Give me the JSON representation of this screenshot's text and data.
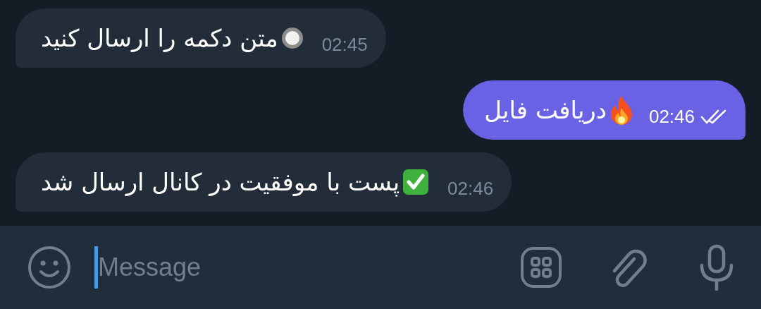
{
  "messages": [
    {
      "text": "متن دکمه را ارسال کنید",
      "time": "02:45",
      "outgoing": false,
      "kind": "radio",
      "read": false
    },
    {
      "text": "دریافت فایل",
      "time": "02:46",
      "outgoing": true,
      "kind": "fire",
      "read": true
    },
    {
      "text": "پست با موفقیت در کانال ارسال شد",
      "time": "02:46",
      "outgoing": false,
      "kind": "check",
      "read": false
    }
  ],
  "composer": {
    "placeholder": "Message"
  }
}
